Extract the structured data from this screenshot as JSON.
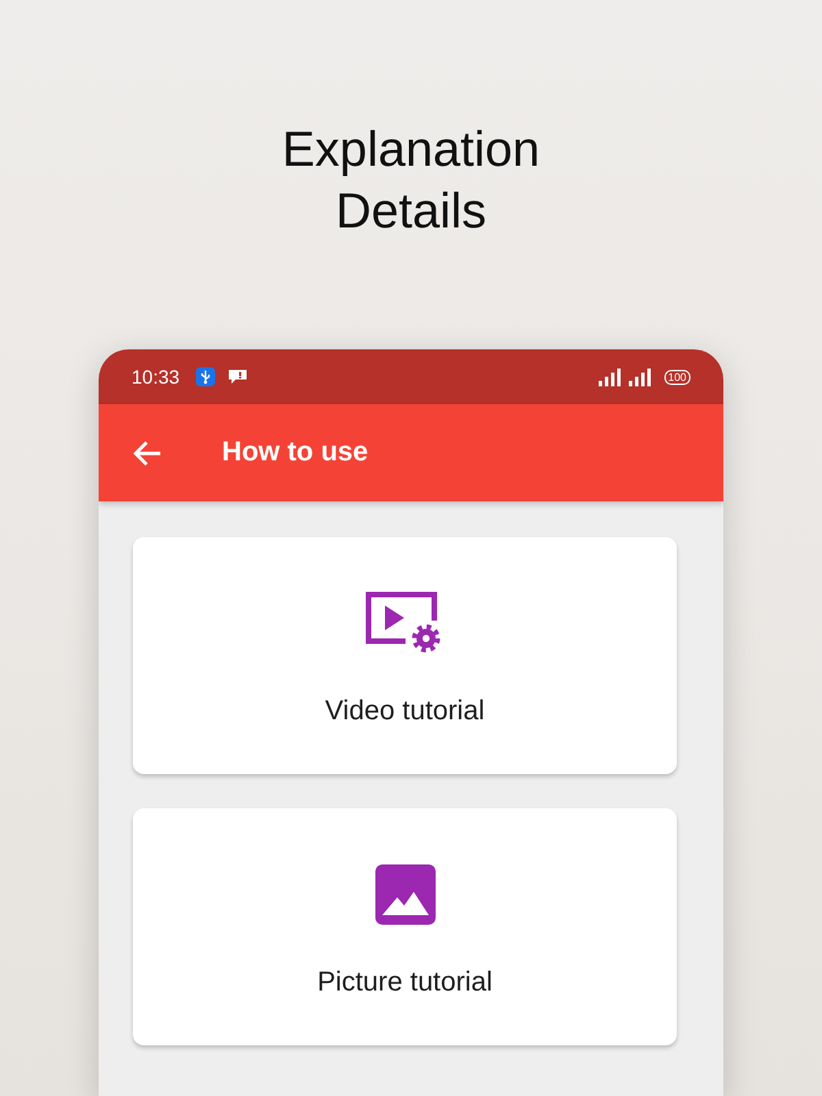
{
  "header": {
    "title": "Explanation Details"
  },
  "status_bar": {
    "time": "10:33",
    "battery": "100"
  },
  "app_bar": {
    "title": "How to use"
  },
  "tutorials": [
    {
      "kind": "video",
      "label": "Video tutorial"
    },
    {
      "kind": "picture",
      "label": "Picture tutorial"
    }
  ]
}
